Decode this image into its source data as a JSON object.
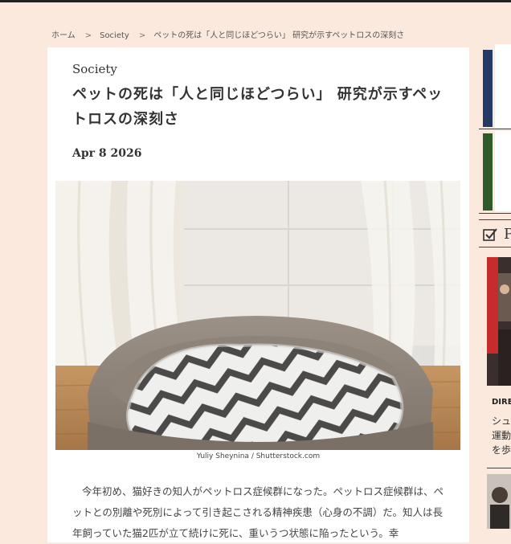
{
  "breadcrumb": {
    "home": "ホーム",
    "sep1": ">",
    "section": "Society",
    "sep2": ">",
    "current": "ペットの死は「人と同じほどつらい」 研究が示すペットロスの深刻さ"
  },
  "article": {
    "category": "Society",
    "title": "ペットの死は「人と同じほどつらい」 研究が示すペットロスの深刻さ",
    "date": "Apr 8 2026",
    "image_credit": "Yuliy Sheynina / Shutterstock.com",
    "body": "今年初め、猫好きの知人がペットロス症候群になった。ペットロス症候群は、ペットとの別離や死別によって引き起こされる精神疾患（心身の不調）だ。知人は長年飼っていた猫2匹が立て続けに死に、重いうつ状態に陥ったという。幸"
  },
  "sidebar": {
    "heading_initial": "P",
    "label": "DIRE",
    "teaser_lines": [
      "シュ",
      "運動",
      "を歩"
    ]
  },
  "colors": {
    "background": "#fbe9de",
    "accent_blue": "#243a66",
    "accent_green": "#2f5a2a"
  }
}
